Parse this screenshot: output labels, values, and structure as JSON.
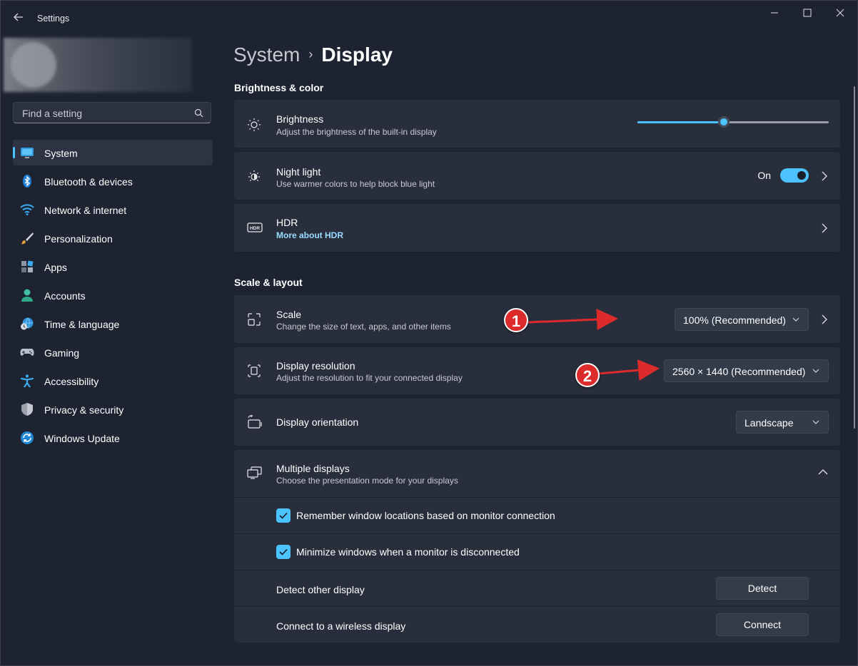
{
  "app": {
    "title": "Settings"
  },
  "search": {
    "placeholder": "Find a setting"
  },
  "sidebar": {
    "items": [
      {
        "label": "System",
        "icon": "monitor-icon",
        "active": true
      },
      {
        "label": "Bluetooth & devices",
        "icon": "bluetooth-icon"
      },
      {
        "label": "Network & internet",
        "icon": "wifi-icon"
      },
      {
        "label": "Personalization",
        "icon": "brush-icon"
      },
      {
        "label": "Apps",
        "icon": "apps-icon"
      },
      {
        "label": "Accounts",
        "icon": "person-icon"
      },
      {
        "label": "Time & language",
        "icon": "globe-clock-icon"
      },
      {
        "label": "Gaming",
        "icon": "gamepad-icon"
      },
      {
        "label": "Accessibility",
        "icon": "accessibility-icon"
      },
      {
        "label": "Privacy & security",
        "icon": "shield-icon"
      },
      {
        "label": "Windows Update",
        "icon": "update-icon"
      }
    ]
  },
  "breadcrumb": {
    "parent": "System",
    "current": "Display"
  },
  "sections": {
    "brightness_color": "Brightness & color",
    "scale_layout": "Scale & layout"
  },
  "brightness": {
    "title": "Brightness",
    "subtitle": "Adjust the brightness of the built-in display",
    "level": 0.45
  },
  "night_light": {
    "title": "Night light",
    "subtitle": "Use warmer colors to help block blue light",
    "state_label": "On"
  },
  "hdr": {
    "title": "HDR",
    "link": "More about HDR"
  },
  "scale": {
    "title": "Scale",
    "subtitle": "Change the size of text, apps, and other items",
    "value": "100% (Recommended)"
  },
  "resolution": {
    "title": "Display resolution",
    "subtitle": "Adjust the resolution to fit your connected display",
    "value": "2560 × 1440 (Recommended)"
  },
  "orientation": {
    "title": "Display orientation",
    "value": "Landscape"
  },
  "multiple_displays": {
    "title": "Multiple displays",
    "subtitle": "Choose the presentation mode for your displays",
    "remember_label": "Remember window locations based on monitor connection",
    "minimize_label": "Minimize windows when a monitor is disconnected",
    "detect_label": "Detect other display",
    "detect_button": "Detect",
    "connect_label": "Connect to a wireless display",
    "connect_button": "Connect"
  },
  "annotations": {
    "marker1": "1",
    "marker2": "2"
  },
  "colors": {
    "accent": "#4cc2ff",
    "background": "#1d2331",
    "card": "#282e3c",
    "marker": "#dd2b2b"
  }
}
